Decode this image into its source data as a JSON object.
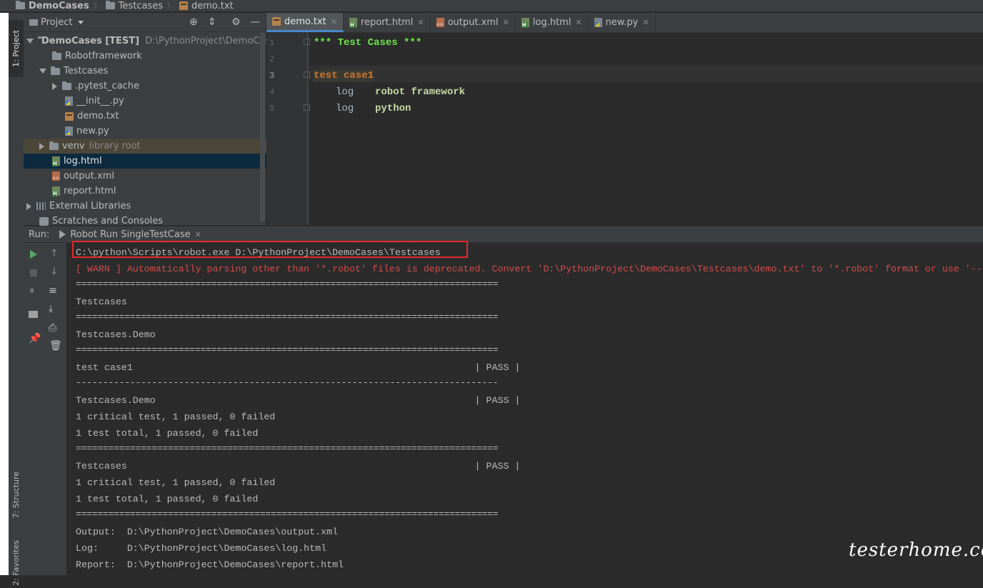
{
  "breadcrumb": {
    "items": [
      {
        "label": "DemoCases",
        "icon": "folder-icon"
      },
      {
        "label": "Testcases",
        "icon": "folder-icon"
      },
      {
        "label": "demo.txt",
        "icon": "robot-file-icon"
      }
    ]
  },
  "tool_windows": {
    "project": "1: Project",
    "structure": "7: Structure",
    "favorites": "2: Favorites"
  },
  "project_panel": {
    "title": "Project",
    "tree": [
      {
        "label": "DemoCases [TEST]",
        "suffix": "D:\\PythonProject\\DemoCases",
        "icon": "folder-icon",
        "expanded": true
      },
      {
        "label": "Robotframework",
        "icon": "folder-icon"
      },
      {
        "label": "Testcases",
        "icon": "folder-icon",
        "expanded": true
      },
      {
        "label": ".pytest_cache",
        "icon": "folder-icon",
        "expanded": false
      },
      {
        "label": "__init__.py",
        "icon": "python-file-icon"
      },
      {
        "label": "demo.txt",
        "icon": "robot-file-icon"
      },
      {
        "label": "new.py",
        "icon": "python-file-icon"
      },
      {
        "label": "venv",
        "suffix": "library root",
        "icon": "folder-icon",
        "expanded": false
      },
      {
        "label": "log.html",
        "icon": "html-file-icon",
        "selected": true
      },
      {
        "label": "output.xml",
        "icon": "xml-file-icon"
      },
      {
        "label": "report.html",
        "icon": "html-file-icon"
      },
      {
        "label": "External Libraries",
        "icon": "library-icon",
        "expanded": false
      },
      {
        "label": "Scratches and Consoles",
        "icon": "scratch-icon"
      }
    ]
  },
  "editor": {
    "tabs": [
      {
        "label": "demo.txt",
        "icon": "robot-file-icon",
        "active": true
      },
      {
        "label": "report.html",
        "icon": "html-file-icon"
      },
      {
        "label": "output.xml",
        "icon": "xml-file-icon"
      },
      {
        "label": "log.html",
        "icon": "html-file-icon"
      },
      {
        "label": "new.py",
        "icon": "python-file-icon"
      }
    ],
    "line_numbers": [
      "1",
      "2",
      "3",
      "4",
      "5"
    ],
    "lines": {
      "l1": "*** Test Cases ***",
      "l3": "test case1",
      "l4_kw": "log",
      "l4_arg": "robot framework",
      "l5_kw": "log",
      "l5_arg": "python"
    }
  },
  "run_panel": {
    "label": "Run:",
    "tab": "Robot Run SingleTestCase",
    "console": [
      "C:\\python\\Scripts\\robot.exe D:\\PythonProject\\DemoCases\\Testcases",
      "[ WARN ] Automatically parsing other than '*.robot' files is deprecated. Convert 'D:\\PythonProject\\DemoCases\\Testcases\\demo.txt' to '*.robot' format or use '--",
      "==============================================================================",
      "Testcases",
      "==============================================================================",
      "Testcases.Demo",
      "==============================================================================",
      "test case1                                                            | PASS |",
      "------------------------------------------------------------------------------",
      "Testcases.Demo                                                        | PASS |",
      "1 critical test, 1 passed, 0 failed",
      "1 test total, 1 passed, 0 failed",
      "==============================================================================",
      "Testcases                                                             | PASS |",
      "1 critical test, 1 passed, 0 failed",
      "1 test total, 1 passed, 0 failed",
      "==============================================================================",
      "Output:  D:\\PythonProject\\DemoCases\\output.xml",
      "Log:     D:\\PythonProject\\DemoCases\\log.html",
      "Report:  D:\\PythonProject\\DemoCases\\report.html"
    ]
  },
  "watermark": "testerhome.com",
  "colors": {
    "background": "#2b2b2b",
    "panel": "#3c3f41",
    "selection": "#0d293e",
    "warn": "#d24b4b",
    "highlight_box": "#e8282b",
    "run_green": "#59a869"
  }
}
